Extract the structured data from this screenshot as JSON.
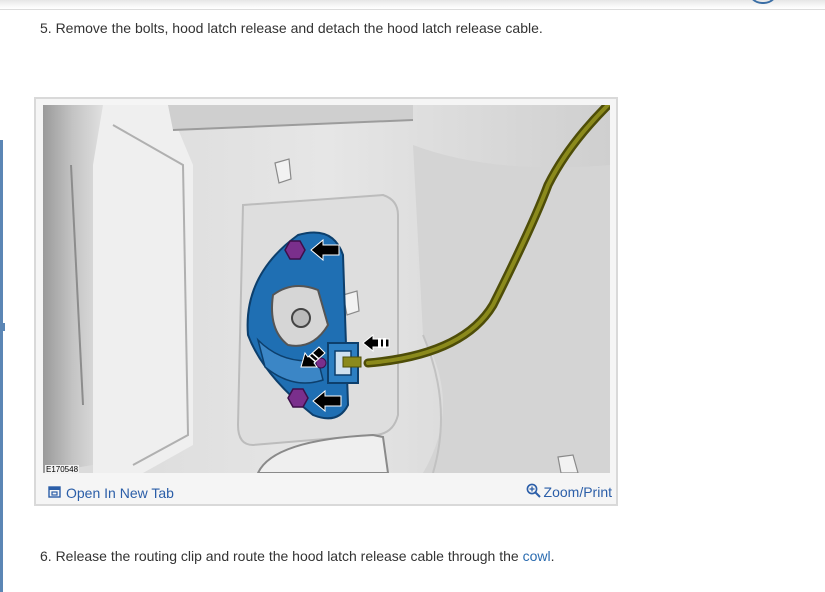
{
  "steps": {
    "step5": "5. Remove the bolts, hood latch release and detach the hood latch release cable.",
    "step6_before": "6. Release the routing clip and route the hood latch release cable through the ",
    "step6_link": "cowl",
    "step6_after": "."
  },
  "figure": {
    "id": "E170548",
    "open_label": "Open In New Tab",
    "zoom_label": "Zoom/Print"
  },
  "icons": {
    "open": "open-in-new-tab-icon",
    "zoom": "zoom-in-icon"
  },
  "colors": {
    "link": "#2b5ea8",
    "latch_blue": "#1f6fb3",
    "cable_olive": "#6b6a0e",
    "bolt_purple": "#7a2f8c"
  }
}
